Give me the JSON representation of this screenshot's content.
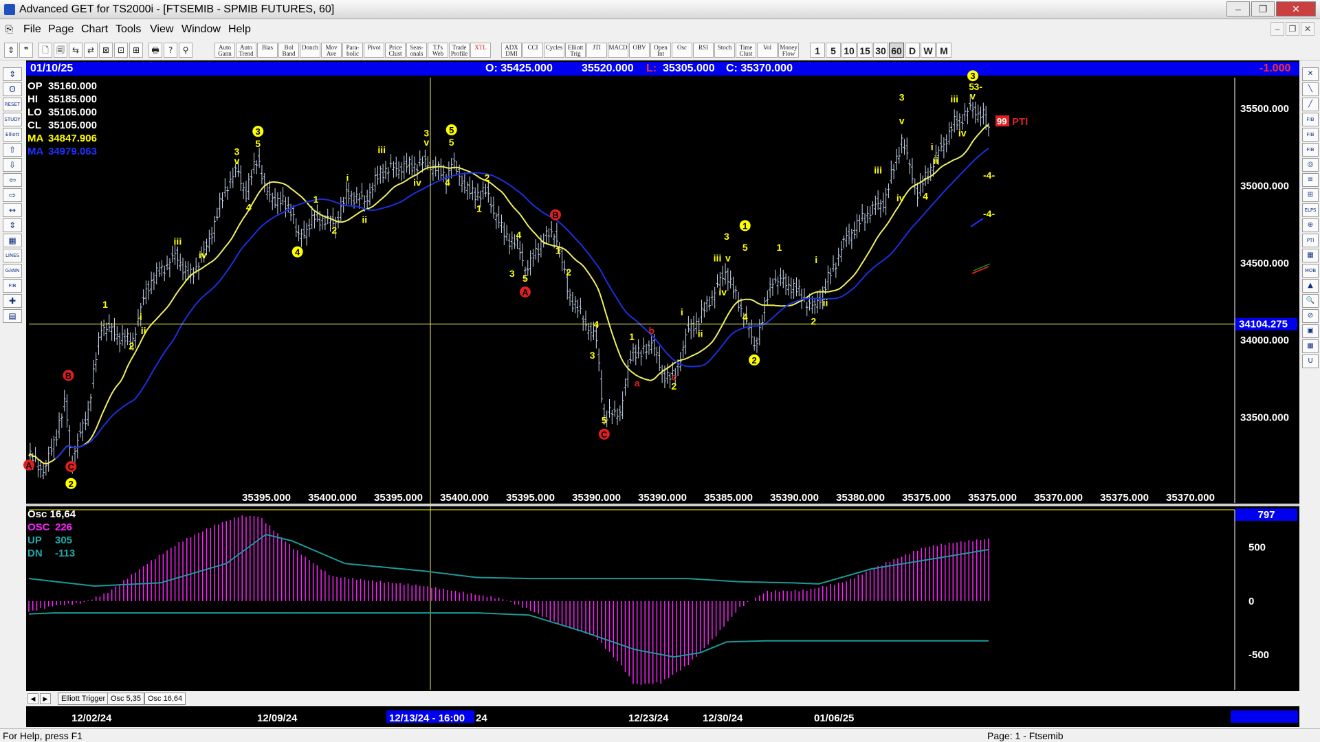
{
  "window": {
    "title": "Advanced GET for TS2000i - [FTSEMIB - SPMIB FUTURES, 60]",
    "buttons": {
      "minimize": "‒",
      "maximize": "❐",
      "close": "✕"
    }
  },
  "menu": [
    "File",
    "Page",
    "Chart",
    "Tools",
    "View",
    "Window",
    "Help"
  ],
  "toolbar": {
    "studies": [
      "Auto Gann",
      "Auto Trend",
      "Bias",
      "Bol Band",
      "Donch",
      "Mov Ave",
      "Para-bolic",
      "Pivot",
      "Price Clust",
      "Seas-onals",
      "TJ's Web",
      "Trade Profile",
      "XTL",
      "ADX DMI",
      "CCI",
      "Cycles",
      "Elliott Trig",
      "JTI",
      "MACD",
      "OBV",
      "Open Int",
      "Osc",
      "RSI",
      "Stoch",
      "Time Clust",
      "Vol",
      "Money Flow"
    ],
    "periods": [
      "1",
      "5",
      "10",
      "15",
      "30",
      "60",
      "D",
      "W",
      "M"
    ],
    "active_period": "60"
  },
  "left_tools": [
    "⇕",
    "ʘ",
    "RESET",
    "STUDY",
    "Elliott",
    "⇧",
    "⇩",
    "⇦",
    "⇨",
    "↔",
    "⇕",
    "▦",
    "LINES",
    "GANN",
    "FIB",
    "✚",
    "▤"
  ],
  "right_tools": [
    "✕",
    "╲",
    "╱",
    "FIB RET",
    "FIB EXT",
    "FIB TIME",
    "◎",
    "≡",
    "⊞",
    "ELPS",
    "⊕",
    "PTI",
    "▦",
    "MOB",
    "▲",
    "🔍",
    "⊘",
    "▣",
    "▦",
    "U"
  ],
  "info_bar": {
    "date": "01/10/25",
    "open": "O: 35425.000",
    "high": "35520.000",
    "low_label": "L:",
    "low": "35305.000",
    "close": "C: 35370.000",
    "change": "-1.000"
  },
  "price_panel": {
    "readout": [
      {
        "label": "OP",
        "value": "35160.000",
        "color": "#ffffff"
      },
      {
        "label": "HI",
        "value": "35185.000",
        "color": "#ffffff"
      },
      {
        "label": "LO",
        "value": "35105.000",
        "color": "#ffffff"
      },
      {
        "label": "CL",
        "value": "35105.000",
        "color": "#ffffff"
      },
      {
        "label": "MA",
        "value": "34847.906",
        "color": "#ffff00"
      },
      {
        "label": "MA",
        "value": "34979.063",
        "color": "#2030ff"
      }
    ],
    "y_axis_labels": [
      "35500.000",
      "35000.000",
      "34500.000",
      "34000.000",
      "33500.000"
    ],
    "y_range": [
      33000,
      35700
    ],
    "crosshair_price": "34104.275",
    "bottom_values": [
      "35395.000",
      "35400.000",
      "35395.000",
      "35400.000",
      "35395.000",
      "35390.000",
      "35390.000",
      "35385.000",
      "35390.000",
      "35380.000",
      "35375.000",
      "35375.000",
      "35370.000",
      "35375.000",
      "35370.000"
    ],
    "pti_value": "99",
    "pti_label": "PTI",
    "projection_labels": [
      "-4-",
      "-4-"
    ],
    "wave_labels": [
      {
        "t": "A",
        "c": "red",
        "x": 0,
        "p": 33170
      },
      {
        "t": "B",
        "c": "red",
        "x": 30,
        "p": 33750
      },
      {
        "t": "C",
        "c": "red",
        "x": 32,
        "p": 33160
      },
      {
        "t": "2",
        "c": "yc",
        "x": 32,
        "p": 33050
      },
      {
        "t": "1",
        "c": "y",
        "x": 58,
        "p": 34210
      },
      {
        "t": "i",
        "c": "y",
        "x": 85,
        "p": 34130
      },
      {
        "t": "ii",
        "c": "y",
        "x": 87,
        "p": 34040
      },
      {
        "t": "2",
        "c": "y",
        "x": 78,
        "p": 33940
      },
      {
        "t": "iii",
        "c": "y",
        "x": 113,
        "p": 34620
      },
      {
        "t": "iv",
        "c": "y",
        "x": 132,
        "p": 34530
      },
      {
        "t": "3",
        "c": "y",
        "x": 158,
        "p": 35200
      },
      {
        "t": "v",
        "c": "y",
        "x": 158,
        "p": 35140
      },
      {
        "t": "4",
        "c": "y",
        "x": 167,
        "p": 34840
      },
      {
        "t": "3",
        "c": "yc",
        "x": 174,
        "p": 35330
      },
      {
        "t": "5",
        "c": "y",
        "x": 174,
        "p": 35250
      },
      {
        "t": "1",
        "c": "y",
        "x": 218,
        "p": 34890
      },
      {
        "t": "2",
        "c": "y",
        "x": 232,
        "p": 34690
      },
      {
        "t": "4",
        "c": "yc",
        "x": 204,
        "p": 34550
      },
      {
        "t": "i",
        "c": "y",
        "x": 242,
        "p": 35030
      },
      {
        "t": "ii",
        "c": "y",
        "x": 255,
        "p": 34760
      },
      {
        "t": "iii",
        "c": "y",
        "x": 268,
        "p": 35210
      },
      {
        "t": "iv",
        "c": "y",
        "x": 295,
        "p": 35000
      },
      {
        "t": "3",
        "c": "y",
        "x": 302,
        "p": 35320
      },
      {
        "t": "v",
        "c": "y",
        "x": 302,
        "p": 35260
      },
      {
        "t": "5",
        "c": "yc",
        "x": 321,
        "p": 35340
      },
      {
        "t": "5",
        "c": "y",
        "x": 321,
        "p": 35260
      },
      {
        "t": "4",
        "c": "y",
        "x": 318,
        "p": 35000
      },
      {
        "t": "2",
        "c": "y",
        "x": 348,
        "p": 35030
      },
      {
        "t": "1",
        "c": "y",
        "x": 342,
        "p": 34830
      },
      {
        "t": "B",
        "c": "red",
        "x": 400,
        "p": 34790
      },
      {
        "t": "4",
        "c": "y",
        "x": 372,
        "p": 34660
      },
      {
        "t": "1",
        "c": "y",
        "x": 402,
        "p": 34560
      },
      {
        "t": "3",
        "c": "y",
        "x": 367,
        "p": 34410
      },
      {
        "t": "5",
        "c": "y",
        "x": 377,
        "p": 34380
      },
      {
        "t": "A",
        "c": "red",
        "x": 377,
        "p": 34290
      },
      {
        "t": "2",
        "c": "y",
        "x": 410,
        "p": 34420
      },
      {
        "t": "4",
        "c": "y",
        "x": 431,
        "p": 34080
      },
      {
        "t": "3",
        "c": "y",
        "x": 428,
        "p": 33880
      },
      {
        "t": "5",
        "c": "y",
        "x": 437,
        "p": 33460
      },
      {
        "t": "C",
        "c": "red",
        "x": 437,
        "p": 33370
      },
      {
        "t": "1",
        "c": "y",
        "x": 458,
        "p": 34000
      },
      {
        "t": "a",
        "c": "red",
        "x": 462,
        "p": 33700
      },
      {
        "t": "b",
        "c": "red",
        "x": 473,
        "p": 34040
      },
      {
        "t": "c",
        "c": "red",
        "x": 490,
        "p": 33740
      },
      {
        "t": "2",
        "c": "y",
        "x": 490,
        "p": 33680
      },
      {
        "t": "i",
        "c": "y",
        "x": 496,
        "p": 34160
      },
      {
        "t": "ii",
        "c": "y",
        "x": 510,
        "p": 34020
      },
      {
        "t": "3",
        "c": "y",
        "x": 530,
        "p": 34650
      },
      {
        "t": "iii",
        "c": "y",
        "x": 523,
        "p": 34510
      },
      {
        "t": "v",
        "c": "y",
        "x": 531,
        "p": 34510
      },
      {
        "t": "iv",
        "c": "y",
        "x": 527,
        "p": 34290
      },
      {
        "t": "1",
        "c": "yc",
        "x": 544,
        "p": 34720
      },
      {
        "t": "5",
        "c": "y",
        "x": 544,
        "p": 34580
      },
      {
        "t": "4",
        "c": "y",
        "x": 544,
        "p": 34130
      },
      {
        "t": "2",
        "c": "yc",
        "x": 551,
        "p": 33850
      },
      {
        "t": "1",
        "c": "y",
        "x": 570,
        "p": 34580
      },
      {
        "t": "i",
        "c": "y",
        "x": 598,
        "p": 34500
      },
      {
        "t": "ii",
        "c": "y",
        "x": 605,
        "p": 34220
      },
      {
        "t": "2",
        "c": "y",
        "x": 596,
        "p": 34100
      },
      {
        "t": "iii",
        "c": "y",
        "x": 645,
        "p": 35080
      },
      {
        "t": "iv",
        "c": "y",
        "x": 662,
        "p": 34900
      },
      {
        "t": "3",
        "c": "y",
        "x": 663,
        "p": 35550
      },
      {
        "t": "v",
        "c": "y",
        "x": 663,
        "p": 35400
      },
      {
        "t": "4",
        "c": "y",
        "x": 681,
        "p": 34910
      },
      {
        "t": "i",
        "c": "y",
        "x": 686,
        "p": 35230
      },
      {
        "t": "ii",
        "c": "y",
        "x": 689,
        "p": 35140
      },
      {
        "t": "iii",
        "c": "y",
        "x": 703,
        "p": 35540
      },
      {
        "t": "iv",
        "c": "y",
        "x": 709,
        "p": 35320
      },
      {
        "t": "3",
        "c": "yc",
        "x": 717,
        "p": 35690
      },
      {
        "t": "5",
        "c": "y",
        "x": 716,
        "p": 35620
      },
      {
        "t": "3-",
        "c": "y",
        "x": 721,
        "p": 35620
      },
      {
        "t": "v",
        "c": "y",
        "x": 717,
        "p": 35560
      }
    ]
  },
  "oscillator_panel": {
    "readout": [
      {
        "label": "Osc 16,64",
        "value": "",
        "color": "#ffffff"
      },
      {
        "label": "OSC",
        "value": "226",
        "color": "#ff22ff"
      },
      {
        "label": "UP",
        "value": "305",
        "color": "#22aaaa"
      },
      {
        "label": "DN",
        "value": "-113",
        "color": "#22aaaa"
      }
    ],
    "y_axis_labels": [
      "500",
      "0",
      "-500"
    ],
    "y_range": [
      -800,
      850
    ],
    "current_value": "797"
  },
  "date_axis": {
    "labels": [
      "12/02/24",
      "12/09/24",
      "24",
      "12/23/24",
      "12/30/24",
      "01/06/25"
    ],
    "cursor_date": "12/13/24 - 16:00"
  },
  "tabs": [
    "Elliott Trigger",
    "Osc 5,35",
    "Osc 16,64"
  ],
  "active_tab": "Osc 16,64",
  "status": {
    "left": "For Help, press F1",
    "right": "Page: 1 - Ftsemib"
  },
  "colors": {
    "price_bars": "#c8d8f0",
    "ma_fast": "#f0f060",
    "ma_slow": "#1a30e0",
    "osc_hist": "#ff22ff",
    "osc_band": "#1a9a9a",
    "crosshair": "#f0f060",
    "info_bg": "#0000f0"
  }
}
